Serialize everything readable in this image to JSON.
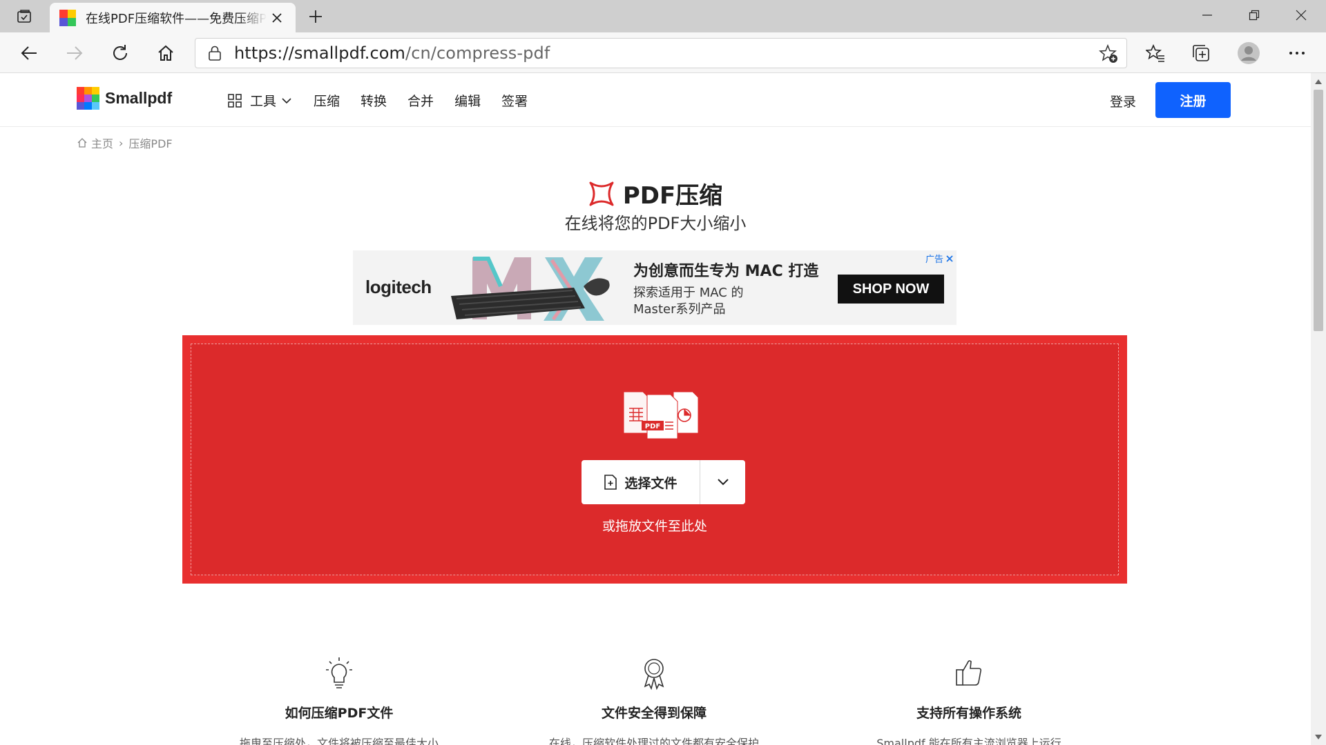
{
  "browser": {
    "tab_title": "在线PDF压缩软件——免费压缩PDF",
    "url_host": "https://smallpdf.com",
    "url_path": "/cn/compress-pdf"
  },
  "site": {
    "logo_text": "Smallpdf",
    "nav": {
      "tools": "工具",
      "items": [
        "压缩",
        "转换",
        "合并",
        "编辑",
        "签署"
      ]
    },
    "login": "登录",
    "signup": "注册"
  },
  "breadcrumb": {
    "home": "主页",
    "sep": "›",
    "current": "压缩PDF"
  },
  "hero": {
    "title": "PDF压缩",
    "subtitle": "在线将您的PDF大小缩小"
  },
  "ad": {
    "brand": "logitech",
    "headline": "为创意而生专为 MAC 打造",
    "body_line1": "探索适用于 MAC 的",
    "body_line2": "Master系列产品",
    "cta": "SHOP NOW",
    "badge": "广告"
  },
  "dropzone": {
    "choose_label": "选择文件",
    "hint": "或拖放文件至此处",
    "pdf_tag": "PDF"
  },
  "features": [
    {
      "title": "如何压缩PDF文件",
      "desc": "拖曳至压缩处，文件将被压缩至最佳大小"
    },
    {
      "title": "文件安全得到保障",
      "desc": "在线，压缩软件处理过的文件都有安全保护"
    },
    {
      "title": "支持所有操作系统",
      "desc": "Smallpdf 能在所有主流浏览器上运行"
    }
  ],
  "colors": {
    "brand_red": "#dc2a2b",
    "brand_blue": "#0f62fe"
  }
}
